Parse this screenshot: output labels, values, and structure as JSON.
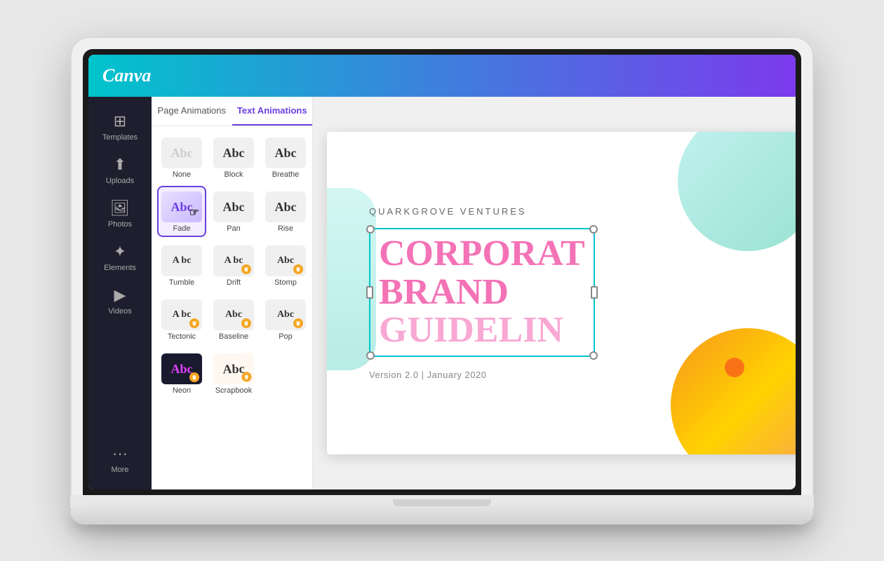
{
  "header": {
    "logo": "Canva"
  },
  "sidebar": {
    "items": [
      {
        "id": "templates",
        "label": "Templates",
        "icon": "⊞"
      },
      {
        "id": "uploads",
        "label": "Uploads",
        "icon": "⬆"
      },
      {
        "id": "photos",
        "label": "Photos",
        "icon": "🖼"
      },
      {
        "id": "elements",
        "label": "Elements",
        "icon": "✦"
      },
      {
        "id": "videos",
        "label": "Videos",
        "icon": "▶"
      },
      {
        "id": "more",
        "label": "More",
        "icon": "···"
      }
    ]
  },
  "panel": {
    "tabs": [
      {
        "id": "page-animations",
        "label": "Page Animations"
      },
      {
        "id": "text-animations",
        "label": "Text Animations"
      }
    ],
    "active_tab": "text-animations",
    "animations": [
      {
        "id": "none",
        "label": "None",
        "text": "Abc",
        "style": "none",
        "selected": false,
        "crown": false
      },
      {
        "id": "block",
        "label": "Block",
        "text": "Abc",
        "style": "block",
        "selected": false,
        "crown": false
      },
      {
        "id": "breathe",
        "label": "Breathe",
        "text": "Abc",
        "style": "breathe",
        "selected": false,
        "crown": false
      },
      {
        "id": "fade",
        "label": "Fade",
        "text": "Abc",
        "style": "fade",
        "selected": true,
        "crown": false
      },
      {
        "id": "pan",
        "label": "Pan",
        "text": "Abc",
        "style": "pan",
        "selected": false,
        "crown": false
      },
      {
        "id": "rise",
        "label": "Rise",
        "text": "Abc",
        "style": "rise",
        "selected": false,
        "crown": false
      },
      {
        "id": "tumble",
        "label": "Tumble",
        "text": "A bc",
        "style": "tumble",
        "selected": false,
        "crown": false
      },
      {
        "id": "drift",
        "label": "Drift",
        "text": "A bc",
        "style": "drift",
        "selected": false,
        "crown": true
      },
      {
        "id": "stomp",
        "label": "Stomp",
        "text": "Abc",
        "style": "stomp",
        "selected": false,
        "crown": true
      },
      {
        "id": "tectonic",
        "label": "Tectonic",
        "text": "A bc",
        "style": "tectonic",
        "selected": false,
        "crown": true
      },
      {
        "id": "baseline",
        "label": "Baseline",
        "text": "Abc",
        "style": "baseline",
        "selected": false,
        "crown": true
      },
      {
        "id": "pop",
        "label": "Pop",
        "text": "Abc",
        "style": "pop",
        "selected": false,
        "crown": true
      },
      {
        "id": "neon",
        "label": "Neon",
        "text": "Abc",
        "style": "neon",
        "selected": false,
        "crown": true
      },
      {
        "id": "scrapbook",
        "label": "Scrapbook",
        "text": "Abc",
        "style": "scrapbook",
        "selected": false,
        "crown": true
      }
    ]
  },
  "canvas": {
    "company_name": "QUARKGROVE VENTURES",
    "headline_line1": "CORPORAT",
    "headline_line2": "BRAND",
    "headline_line3": "GUIDELIN",
    "version": "Version 2.0 | January 2020"
  },
  "colors": {
    "header_gradient_start": "#00c4cc",
    "header_gradient_end": "#7c3aed",
    "active_tab": "#6c3fe0",
    "selected_border": "#6c3fe0",
    "headline_pink": "#f472b6",
    "headline_light_pink": "#f9a8d4",
    "selection_border": "#00c4cc"
  }
}
